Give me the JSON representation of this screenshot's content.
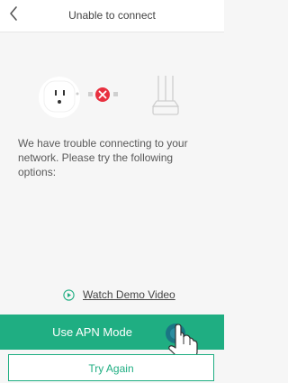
{
  "header": {
    "title": "Unable to connect",
    "back_icon": "chevron-left-icon"
  },
  "illustration": {
    "device_icon": "smart-plug-icon",
    "status_icon": "error-x-icon",
    "router_icon": "router-icon",
    "status_color": "#e8303f"
  },
  "message": {
    "text": "We have trouble connecting to your network. Please try the following options:"
  },
  "demo": {
    "label": "Watch Demo Video",
    "icon": "play-circle-icon"
  },
  "buttons": {
    "apn_label": "Use APN Mode",
    "retry_label": "Try Again",
    "tap_hint_icon": "tap-hand-icon"
  },
  "colors": {
    "accent": "#1fae82",
    "background": "#f6f6f6",
    "text": "#5a5a5a"
  }
}
